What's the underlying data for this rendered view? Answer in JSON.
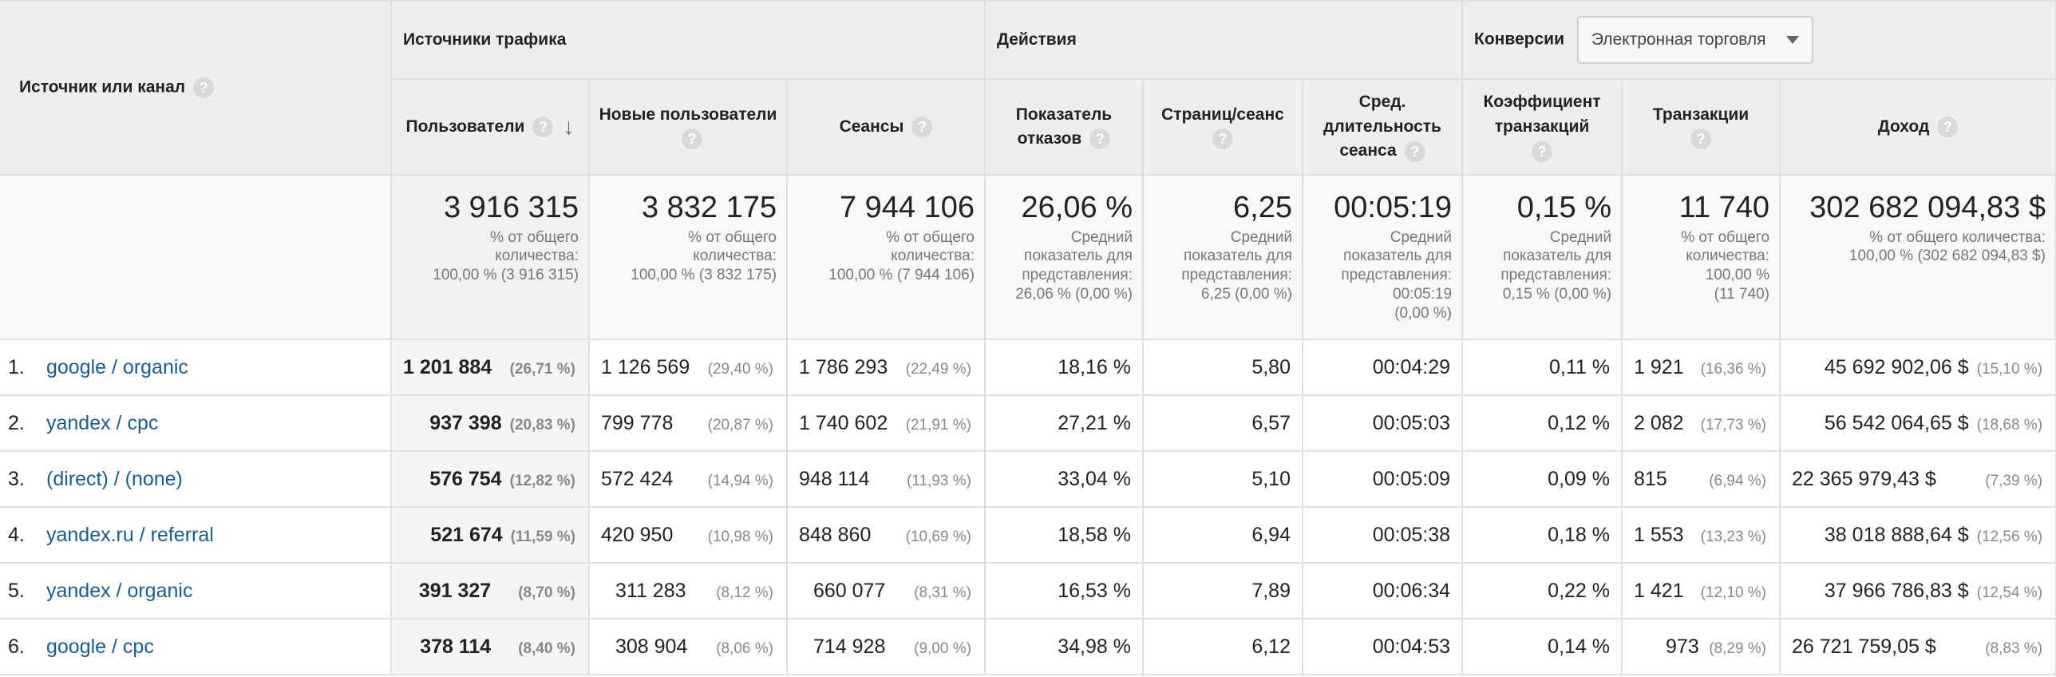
{
  "header": {
    "source_label": "Источник или канал",
    "groups": {
      "traffic": "Источники трафика",
      "actions": "Действия",
      "conversions": "Конверсии"
    },
    "conversion_select": "Электронная торговля",
    "columns": {
      "users": "Пользователи",
      "new_users": "Новые пользователи",
      "sessions": "Сеансы",
      "bounce": "Показатель отказов",
      "pages": "Страниц/сеанс",
      "duration": "Сред. длительность сеанса",
      "conv_rate": "Коэффициент транзакций",
      "transactions": "Транзакции",
      "revenue": "Доход"
    }
  },
  "totals": {
    "users": {
      "value": "3 916 315",
      "l1": "% от общего",
      "l2": "количества:",
      "l3": "100,00 % (3 916 315)"
    },
    "new_users": {
      "value": "3 832 175",
      "l1": "% от общего",
      "l2": "количества:",
      "l3": "100,00 % (3 832 175)"
    },
    "sessions": {
      "value": "7 944 106",
      "l1": "% от общего",
      "l2": "количества:",
      "l3": "100,00 % (7 944 106)"
    },
    "bounce": {
      "value": "26,06 %",
      "l1": "Средний",
      "l2": "показатель для",
      "l3": "представления:",
      "l4": "26,06 % (0,00 %)"
    },
    "pages": {
      "value": "6,25",
      "l1": "Средний",
      "l2": "показатель для",
      "l3": "представления:",
      "l4": "6,25 (0,00 %)"
    },
    "duration": {
      "value": "00:05:19",
      "l1": "Средний",
      "l2": "показатель для",
      "l3": "представления:",
      "l4": "00:05:19",
      "l5": "(0,00 %)"
    },
    "conv_rate": {
      "value": "0,15 %",
      "l1": "Средний",
      "l2": "показатель для",
      "l3": "представления:",
      "l4": "0,15 % (0,00 %)"
    },
    "transactions": {
      "value": "11 740",
      "l1": "% от общего",
      "l2": "количества:",
      "l3": "100,00 %",
      "l4": "(11 740)"
    },
    "revenue": {
      "value": "302 682 094,83 $",
      "l1": "% от общего количества:",
      "l2": "100,00 % (302 682 094,83 $)"
    }
  },
  "rows": [
    {
      "rank": "1.",
      "source": "google / organic",
      "users": "1 201 884",
      "users_pct": "(26,71 %)",
      "new_users": "1 126 569",
      "new_users_pct": "(29,40 %)",
      "sessions": "1 786 293",
      "sessions_pct": "(22,49 %)",
      "bounce": "18,16 %",
      "pages": "5,80",
      "duration": "00:04:29",
      "conv_rate": "0,11 %",
      "transactions": "1 921",
      "transactions_pct": "(16,36 %)",
      "revenue": "45 692 902,06 $",
      "revenue_pct": "(15,10 %)"
    },
    {
      "rank": "2.",
      "source": "yandex / cpc",
      "users": "937 398",
      "users_pct": "(20,83 %)",
      "new_users": "799 778",
      "new_users_pct": "(20,87 %)",
      "sessions": "1 740 602",
      "sessions_pct": "(21,91 %)",
      "bounce": "27,21 %",
      "pages": "6,57",
      "duration": "00:05:03",
      "conv_rate": "0,12 %",
      "transactions": "2 082",
      "transactions_pct": "(17,73 %)",
      "revenue": "56 542 064,65 $",
      "revenue_pct": "(18,68 %)"
    },
    {
      "rank": "3.",
      "source": "(direct) / (none)",
      "users": "576 754",
      "users_pct": "(12,82 %)",
      "new_users": "572 424",
      "new_users_pct": "(14,94 %)",
      "sessions": "948 114",
      "sessions_pct": "(11,93 %)",
      "bounce": "33,04 %",
      "pages": "5,10",
      "duration": "00:05:09",
      "conv_rate": "0,09 %",
      "transactions": "815",
      "transactions_pct": "(6,94 %)",
      "revenue": "22 365 979,43 $",
      "revenue_pct": "(7,39 %)"
    },
    {
      "rank": "4.",
      "source": "yandex.ru / referral",
      "users": "521 674",
      "users_pct": "(11,59 %)",
      "new_users": "420 950",
      "new_users_pct": "(10,98 %)",
      "sessions": "848 860",
      "sessions_pct": "(10,69 %)",
      "bounce": "18,58 %",
      "pages": "6,94",
      "duration": "00:05:38",
      "conv_rate": "0,18 %",
      "transactions": "1 553",
      "transactions_pct": "(13,23 %)",
      "revenue": "38 018 888,64 $",
      "revenue_pct": "(12,56 %)"
    },
    {
      "rank": "5.",
      "source": "yandex / organic",
      "users": "391 327",
      "users_pct": "(8,70 %)",
      "new_users": "311 283",
      "new_users_pct": "(8,12 %)",
      "sessions": "660 077",
      "sessions_pct": "(8,31 %)",
      "bounce": "16,53 %",
      "pages": "7,89",
      "duration": "00:06:34",
      "conv_rate": "0,22 %",
      "transactions": "1 421",
      "transactions_pct": "(12,10 %)",
      "revenue": "37 966 786,83 $",
      "revenue_pct": "(12,54 %)"
    },
    {
      "rank": "6.",
      "source": "google / cpc",
      "users": "378 114",
      "users_pct": "(8,40 %)",
      "new_users": "308 904",
      "new_users_pct": "(8,06 %)",
      "sessions": "714 928",
      "sessions_pct": "(9,00 %)",
      "bounce": "34,98 %",
      "pages": "6,12",
      "duration": "00:04:53",
      "conv_rate": "0,14 %",
      "transactions": "973",
      "transactions_pct": "(8,29 %)",
      "revenue": "26 721 759,05 $",
      "revenue_pct": "(8,83 %)"
    }
  ],
  "icons": {
    "help": "help-icon",
    "sort": "sort-down-arrow-icon",
    "dropdown": "chevron-down-icon"
  }
}
